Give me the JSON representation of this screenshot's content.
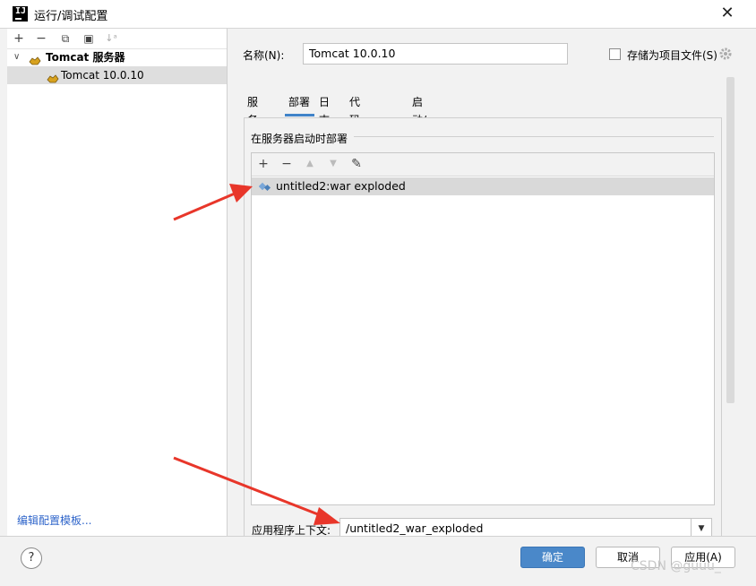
{
  "window": {
    "title": "运行/调试配置",
    "close": "✕"
  },
  "left_toolbar": {
    "add": "+",
    "remove": "−",
    "copy": "⧉",
    "folder": "▣",
    "sort": "↓ᵃ"
  },
  "tree": [
    {
      "label": "Tomcat 服务器",
      "expanded_icon": "∨"
    },
    {
      "label": "Tomcat 10.0.10"
    }
  ],
  "edit_templates_link": "编辑配置模板...",
  "form": {
    "name_label": "名称(N):",
    "name_value": "Tomcat 10.0.10",
    "store_as_project_label": "存储为项目文件(S)"
  },
  "tabs": [
    "服务器",
    "部署",
    "日志",
    "代码覆盖率",
    "启动/连接"
  ],
  "active_tab": "部署",
  "deploy": {
    "section_title": "在服务器启动时部署",
    "toolbar": {
      "add": "+",
      "remove": "−",
      "up": "▲",
      "down": "▼",
      "edit": "✎"
    },
    "artifacts": [
      "untitled2:war exploded"
    ],
    "context_label": "应用程序上下文:",
    "context_value": "/untitled2_war_exploded",
    "combo_arrow": "▼"
  },
  "footer": {
    "help": "?",
    "ok_label": "确定",
    "cancel_label": "取消",
    "apply_label": "应用(A)"
  },
  "watermark": "CSDN @guuu_",
  "colors": {
    "accent": "#4083c9",
    "primary_button": "#4a88c9",
    "link": "#2f65ca",
    "arrow": "#e8362a"
  }
}
